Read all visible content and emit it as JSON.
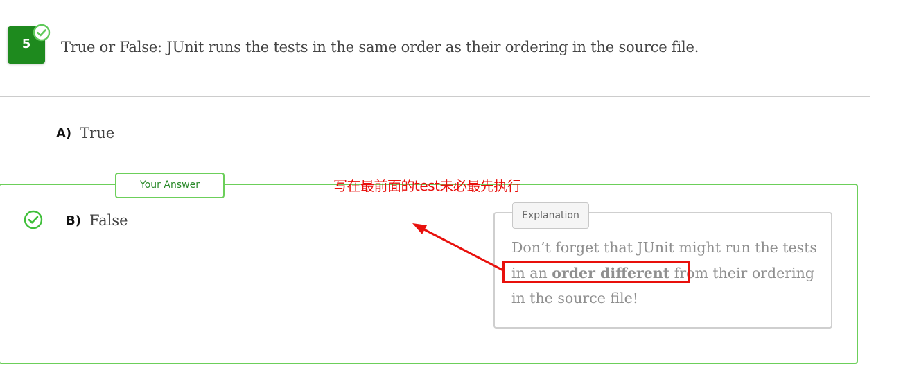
{
  "question": {
    "number": "5",
    "text": "True or False: JUnit runs the tests in the same order as their ordering in the source file."
  },
  "options": [
    {
      "letter": "A)",
      "text": "True"
    },
    {
      "letter": "B)",
      "text": "False"
    }
  ],
  "answer_tag": "Your Answer",
  "explanation": {
    "tag": "Explanation",
    "line1": "Don’t forget that JUnit might run the tests",
    "line2_prefix": "in an ",
    "line2_bold": "order different",
    "line2_suffix": " from their ordering",
    "line3": "in the source file!"
  },
  "annotation": {
    "text": "写在最前面的test未必最先执行",
    "color": "#e8100c"
  },
  "colors": {
    "correct_green": "#1e8a1e",
    "border_green": "#6ccf5a",
    "annotation_red": "#e8100c"
  },
  "icons": {
    "badge_check": "check-circle-icon",
    "answer_check": "check-circle-icon"
  }
}
